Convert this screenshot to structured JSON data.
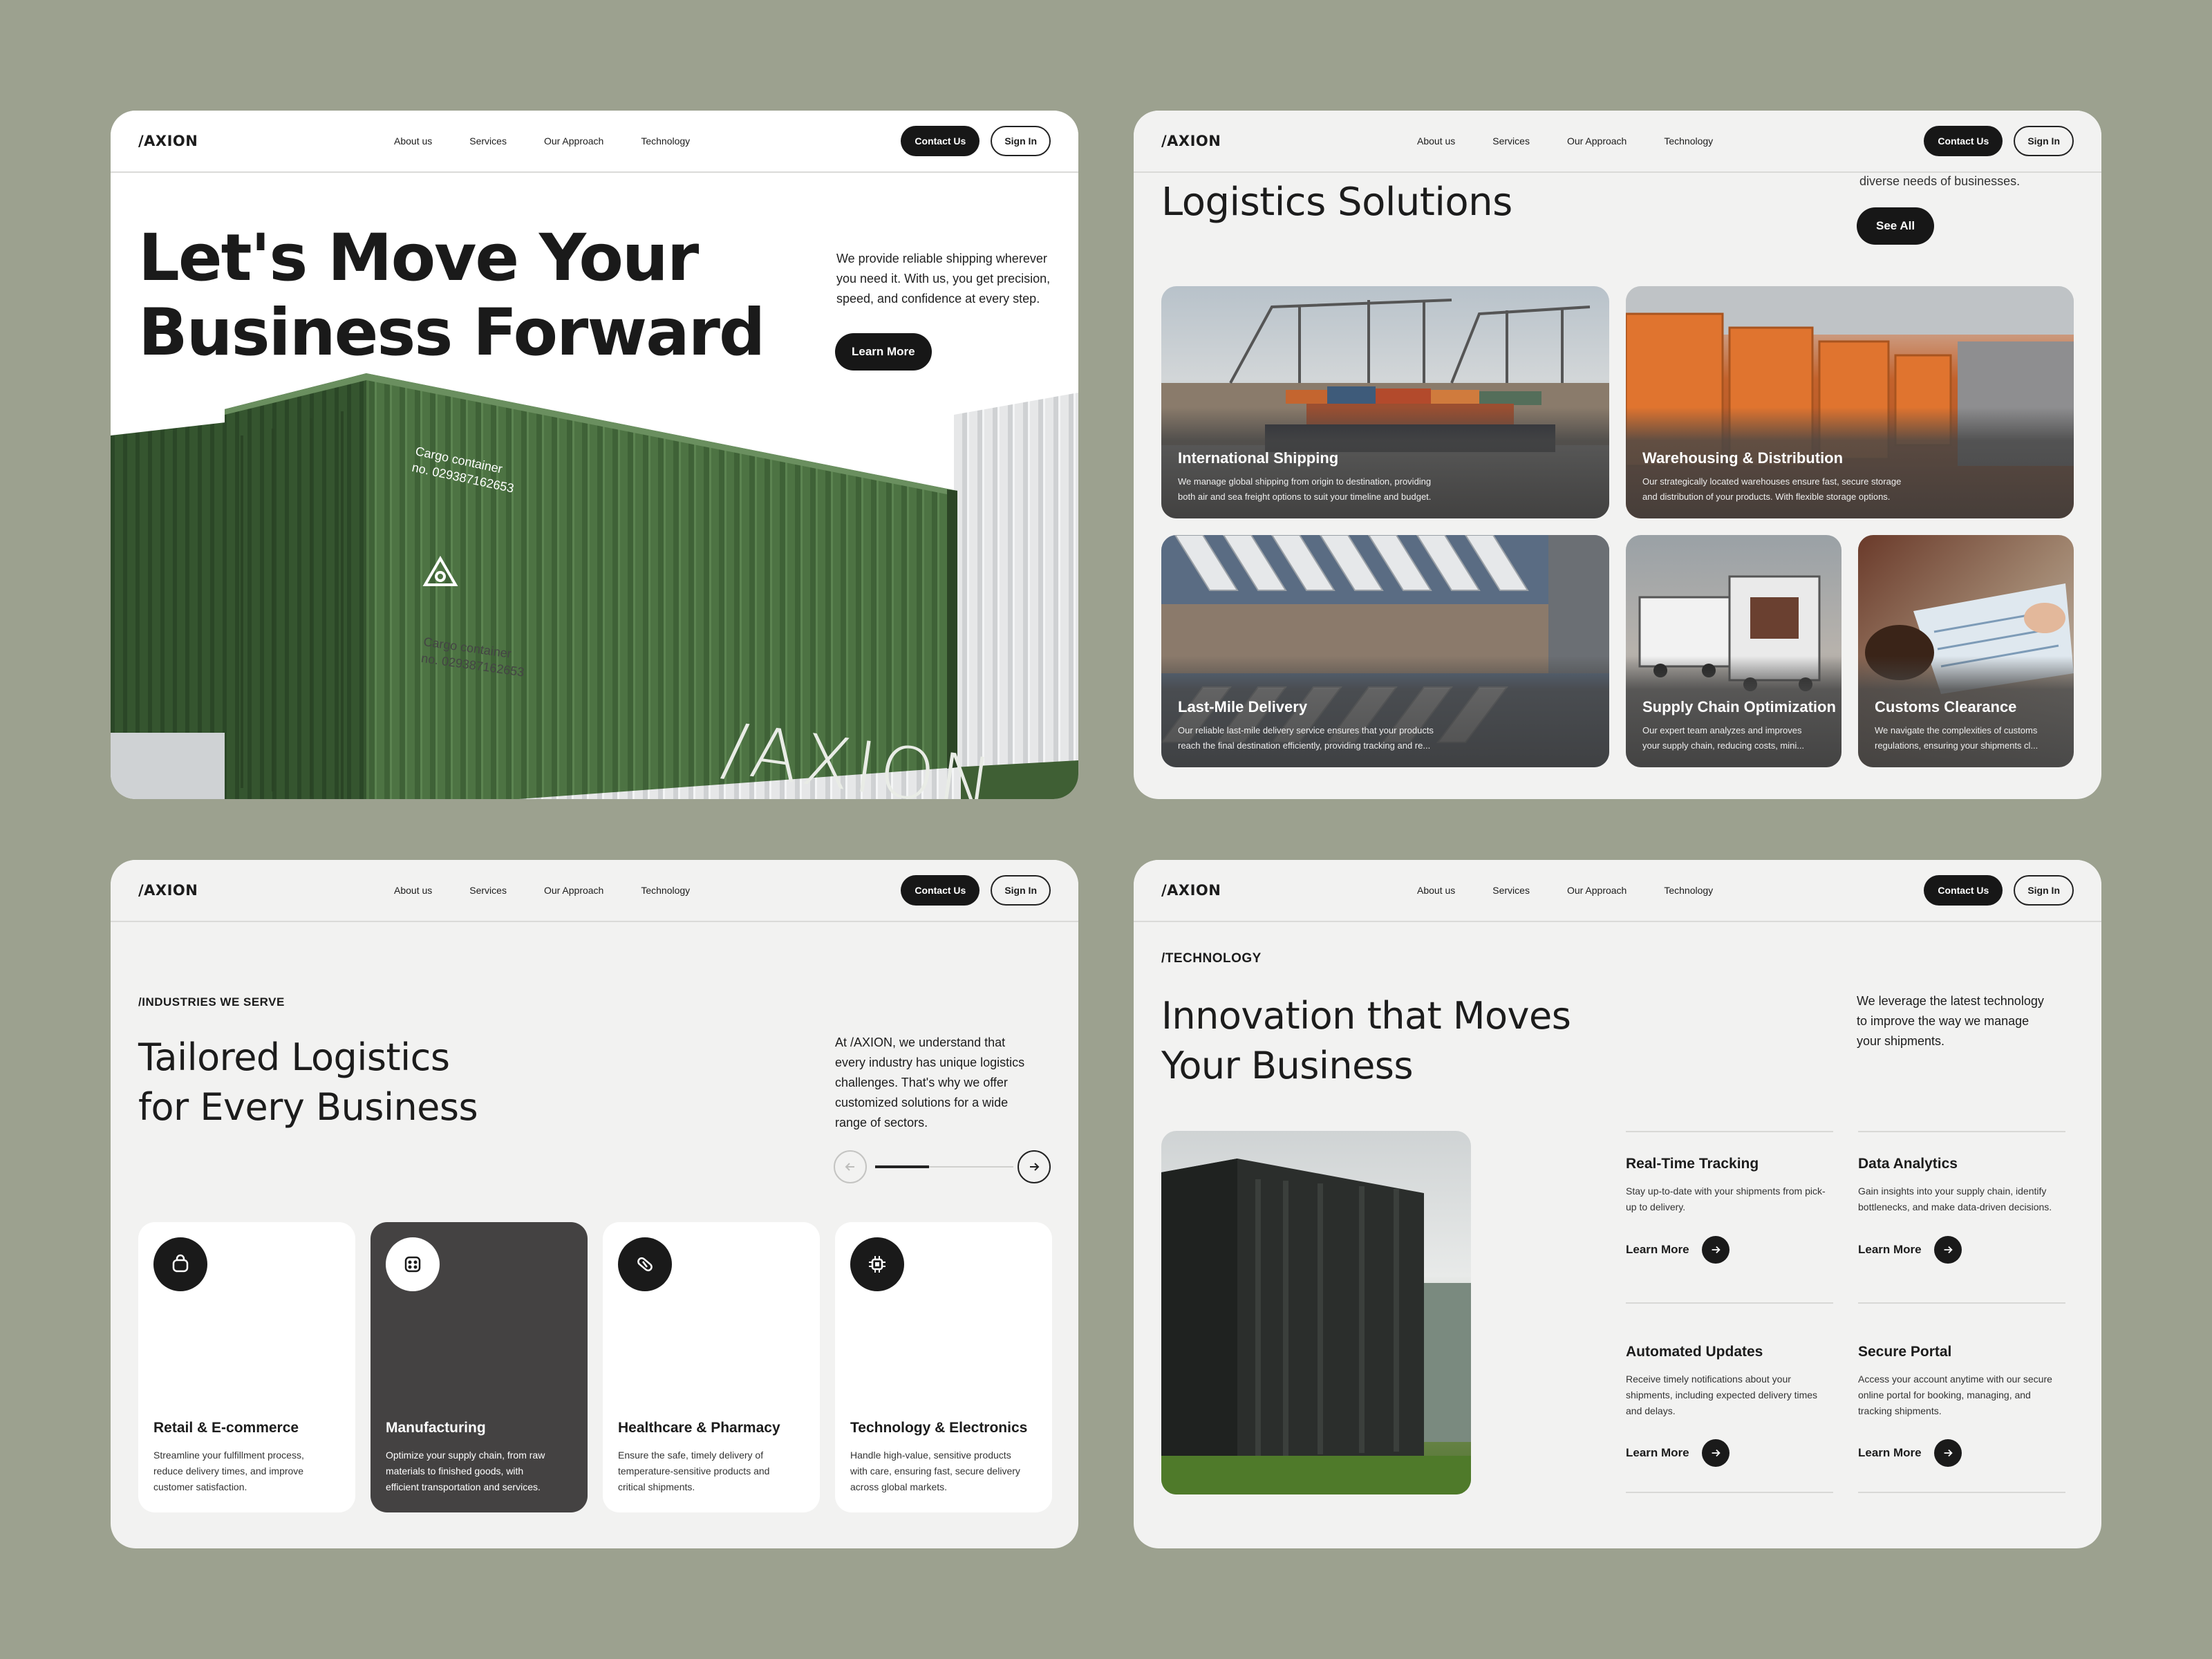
{
  "brand": "/AXION",
  "nav": {
    "links": [
      "About us",
      "Services",
      "Our Approach",
      "Technology"
    ],
    "contact": "Contact Us",
    "signin": "Sign In"
  },
  "hero": {
    "line1": "Let's Move Your",
    "line2": "Business Forward",
    "desc": "We provide reliable shipping wherever you need it. With us, you get precision, speed, and confidence at every step.",
    "cta": "Learn More",
    "container_text1": "Cargo container\nno. 0293871626 53",
    "container_brand": "/AXION"
  },
  "solutions": {
    "title": "Logistics Solutions",
    "top_text": "diverse needs of businesses.",
    "see_all": "See All",
    "cards": [
      {
        "title": "International Shipping",
        "desc": "We manage global shipping from origin to destination, providing\nboth air and sea freight options to suit your timeline and budget."
      },
      {
        "title": "Warehousing & Distribution",
        "desc": "Our strategically located warehouses ensure fast, secure storage\nand distribution of your products. With flexible storage options."
      },
      {
        "title": "Last-Mile Delivery",
        "desc": "Our reliable last-mile delivery service ensures that your products\nreach the final destination efficiently, providing tracking and re..."
      },
      {
        "title": "Supply Chain Optimization",
        "desc": "Our expert team analyzes and improves\nyour supply chain, reducing costs, mini..."
      },
      {
        "title": "Customs Clearance",
        "desc": "We navigate the complexities of customs\nregulations, ensuring your shipments cl..."
      }
    ]
  },
  "industries": {
    "tag": "/INDUSTRIES WE SERVE",
    "title": "Tailored Logistics\nfor Every Business",
    "desc": "At /AXION, we understand that\nevery industry has unique logistics\nchallenges. That's why we offer\ncustomized solutions for a wide\nrange of sectors.",
    "cards": [
      {
        "title": "Retail & E-commerce",
        "desc": "Streamline your fulfillment process,\nreduce delivery times, and improve\ncustomer satisfaction."
      },
      {
        "title": "Manufacturing",
        "desc": "Optimize your supply chain, from raw\nmaterials to finished goods, with\nefficient transportation and services."
      },
      {
        "title": "Healthcare & Pharmacy",
        "desc": "Ensure the safe, timely delivery of\ntemperature-sensitive products and\ncritical shipments."
      },
      {
        "title": "Technology & Electronics",
        "desc": "Handle high-value, sensitive products\nwith care, ensuring fast, secure delivery\nacross global markets."
      }
    ]
  },
  "technology": {
    "tag": "/TECHNOLOGY",
    "title": "Innovation that Moves\nYour Business",
    "desc": "We leverage the latest technology\nto improve the way we manage\nyour shipments.",
    "learn": "Learn More",
    "features": [
      {
        "title": "Real-Time Tracking",
        "desc": "Stay up-to-date with your shipments from pick-\nup to delivery."
      },
      {
        "title": "Data Analytics",
        "desc": "Gain insights into your supply chain, identify\nbottlenecks, and make data-driven decisions."
      },
      {
        "title": "Automated Updates",
        "desc": "Receive timely notifications about your\nshipments, including expected delivery times\nand delays."
      },
      {
        "title": "Secure Portal",
        "desc": "Access your account anytime with our secure\nonline portal for booking, managing, and\ntracking shipments."
      }
    ]
  }
}
